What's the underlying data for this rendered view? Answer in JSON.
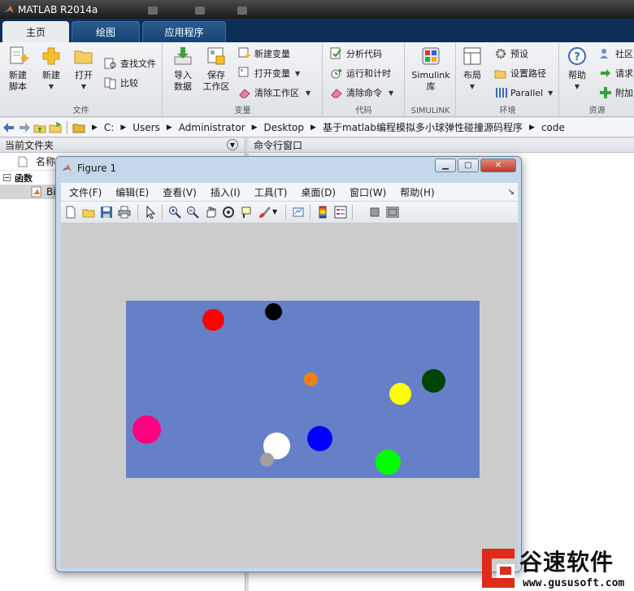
{
  "app": {
    "title": "MATLAB R2014a"
  },
  "ribbon_tabs": [
    {
      "label": "主页",
      "active": true
    },
    {
      "label": "绘图",
      "active": false
    },
    {
      "label": "应用程序",
      "active": false
    }
  ],
  "ribbon": {
    "file": {
      "label": "文件",
      "new_script": "新建\n脚本",
      "new": "新建",
      "open": "打开",
      "find_files": "查找文件",
      "compare": "比较"
    },
    "variable": {
      "label": "变量",
      "import": "导入\n数据",
      "save_ws": "保存\n工作区",
      "new_var": "新建变量",
      "open_var": "打开变量",
      "clear_ws": "清除工作区"
    },
    "code": {
      "label": "代码",
      "analyze": "分析代码",
      "run_time": "运行和计时",
      "clear_cmd": "清除命令"
    },
    "simulink": {
      "label": "SIMULINK",
      "lib": "Simulink\n库"
    },
    "env": {
      "label": "环境",
      "layout": "布局",
      "prefs": "预设",
      "set_path": "设置路径",
      "parallel": "Parallel"
    },
    "resources": {
      "label": "资源",
      "help": "帮助",
      "community": "社区",
      "request": "请求",
      "addons": "附加"
    }
  },
  "address": {
    "crumbs": [
      "C:",
      "Users",
      "Administrator",
      "Desktop",
      "基于matlab编程模拟多小球弹性碰撞源码程序",
      "code"
    ]
  },
  "left_panel": {
    "title": "当前文件夹",
    "col_name": "名称",
    "section": "函数",
    "file_prefix": "Bi"
  },
  "right_panel": {
    "title": "命令行窗口"
  },
  "figure": {
    "title": "Figure 1",
    "menu": [
      "文件(F)",
      "编辑(E)",
      "查看(V)",
      "插入(I)",
      "工具(T)",
      "桌面(D)",
      "窗口(W)",
      "帮助(H)"
    ],
    "axes_color": "#6680c7",
    "bg_color": "#cccccc",
    "ball_colors": {
      "red": "#ff0000",
      "black": "#000000",
      "orange": "#f08018",
      "yellow": "#ffff00",
      "darkgreen": "#004400",
      "magenta": "#ff0080",
      "white": "#ffffff",
      "gray": "#a0a0a0",
      "blue": "#0000ff",
      "green": "#00ff00"
    }
  },
  "watermark": {
    "brand": "谷速软件",
    "url": "www.gususoft.com"
  }
}
